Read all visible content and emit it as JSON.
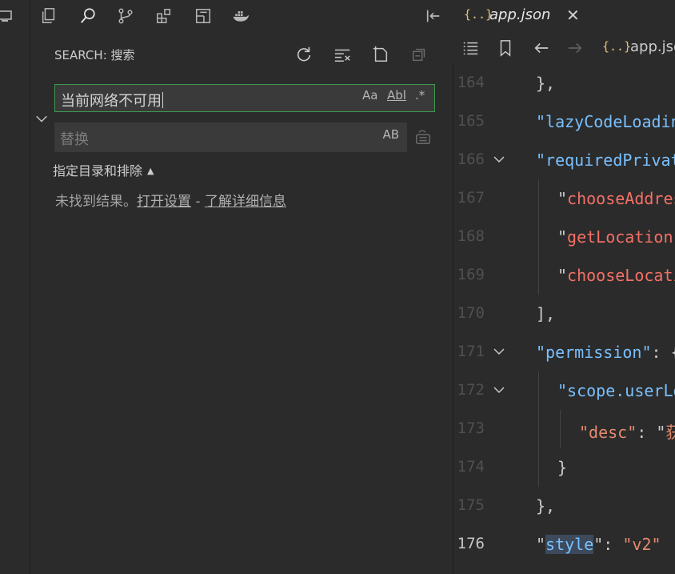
{
  "search": {
    "title": "SEARCH: 搜索",
    "query": "当前网络不可用",
    "option_case": "Aa",
    "option_word": "Abl",
    "option_regex": ".*",
    "replace_placeholder": "替换",
    "replace_preserve_case": "AB",
    "include_toggle": "指定目录和排除",
    "no_results": "未找到结果。",
    "open_settings": "打开设置",
    "separator": " - ",
    "learn_more": "了解详细信息"
  },
  "editor": {
    "tab_icon": "{..}",
    "tab_label": "app.json",
    "tab_close": "✕",
    "breadcrumb_icon": "{..}",
    "breadcrumb_label": "app.json",
    "lines": [
      {
        "num": "164",
        "indent": 1,
        "tokens": [
          {
            "t": "},",
            "c": "punc"
          }
        ]
      },
      {
        "num": "165",
        "indent": 1,
        "tokens": [
          {
            "t": "\"lazyCodeLoading\"",
            "c": "key"
          }
        ]
      },
      {
        "num": "166",
        "indent": 1,
        "fold": true,
        "tokens": [
          {
            "t": "\"requiredPrivateInfos\"",
            "c": "key"
          }
        ]
      },
      {
        "num": "167",
        "indent": 2,
        "tokens": [
          {
            "t": "\"",
            "c": "punc"
          },
          {
            "t": "chooseAddress\",",
            "c": "str"
          }
        ]
      },
      {
        "num": "168",
        "indent": 2,
        "tokens": [
          {
            "t": "\"",
            "c": "punc"
          },
          {
            "t": "getLocation\",",
            "c": "str"
          }
        ]
      },
      {
        "num": "169",
        "indent": 2,
        "tokens": [
          {
            "t": "\"",
            "c": "punc"
          },
          {
            "t": "chooseLocation\"",
            "c": "str"
          }
        ]
      },
      {
        "num": "170",
        "indent": 1,
        "tokens": [
          {
            "t": "],",
            "c": "punc"
          }
        ]
      },
      {
        "num": "171",
        "indent": 1,
        "fold": true,
        "tokens": [
          {
            "t": "\"permission\"",
            "c": "key"
          },
          {
            "t": ": {",
            "c": "punc"
          }
        ]
      },
      {
        "num": "172",
        "indent": 2,
        "fold": true,
        "tokens": [
          {
            "t": "\"scope.userLocation\"",
            "c": "key"
          }
        ]
      },
      {
        "num": "173",
        "indent": 3,
        "tokens": [
          {
            "t": "\"desc\"",
            "c": "strv"
          },
          {
            "t": ": \"",
            "c": "punc"
          },
          {
            "t": "获取",
            "c": "strv"
          }
        ]
      },
      {
        "num": "174",
        "indent": 2,
        "tokens": [
          {
            "t": "}",
            "c": "punc"
          }
        ]
      },
      {
        "num": "175",
        "indent": 1,
        "tokens": [
          {
            "t": "},",
            "c": "punc"
          }
        ]
      },
      {
        "num": "176",
        "indent": 1,
        "active": true,
        "tokens": [
          {
            "t": "\"",
            "c": "punc"
          },
          {
            "t": "style",
            "c": "key hl"
          },
          {
            "t": "\": ",
            "c": "punc"
          },
          {
            "t": "\"v2\"",
            "c": "strv"
          }
        ]
      }
    ]
  }
}
